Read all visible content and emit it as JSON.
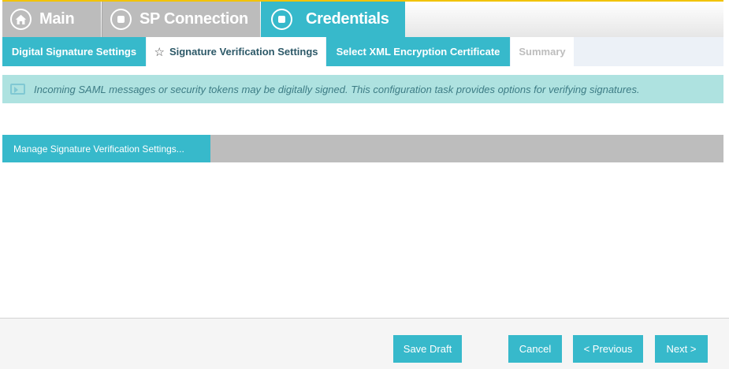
{
  "top_tabs": {
    "main_label": "Main",
    "sp_connection_label": "SP Connection",
    "credentials_label": "Credentials"
  },
  "sub_tabs": {
    "digital_signature_label": "Digital Signature Settings",
    "signature_verification_label": "Signature Verification Settings",
    "xml_encryption_label": "Select XML Encryption Certificate",
    "summary_label": "Summary"
  },
  "info": {
    "message": "Incoming SAML messages or security tokens may be digitally signed. This configuration task provides options for verifying signatures."
  },
  "manage": {
    "button_label": "Manage Signature Verification Settings..."
  },
  "footer": {
    "save_draft_label": "Save Draft",
    "cancel_label": "Cancel",
    "previous_label": "< Previous",
    "next_label": "Next >"
  },
  "icons": {
    "main": "home-icon",
    "sp_connection": "stop-circle-icon",
    "credentials": "stop-circle-icon",
    "current_subtab": "star-icon",
    "info": "message-icon"
  },
  "colors": {
    "accent_teal": "#37b9cb",
    "tab_gray": "#bcbcbc",
    "info_bg": "#aee2e0",
    "top_border": "#f2c300"
  }
}
